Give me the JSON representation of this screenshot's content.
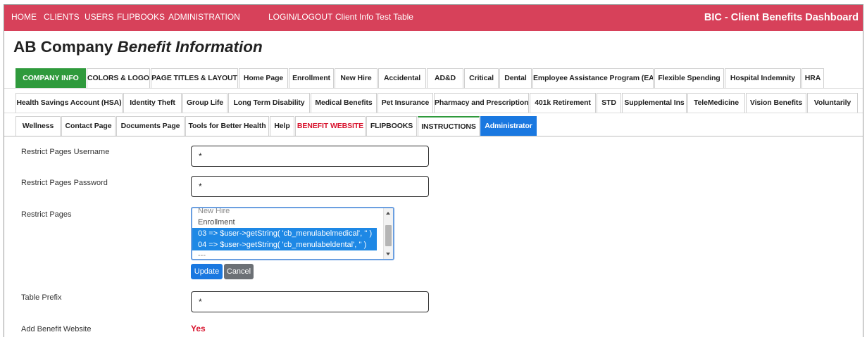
{
  "topnav": {
    "items": [
      "HOME",
      "CLIENTS",
      "USERS",
      "FLIPBOOKS",
      "ADMINISTRATION",
      "LOGIN/LOGOUT",
      "Client Info Test Table"
    ],
    "brand": "BIC - Client Benefits Dashboard",
    "background_color": "#d7415a"
  },
  "page": {
    "title_plain": "AB Company ",
    "title_italic": "Benefit Information"
  },
  "tabs": {
    "row0": [
      "COMPANY INFO",
      "COLORS & LOGO",
      "PAGE TITLES & LAYOUT",
      "Home Page",
      "Enrollment",
      "New Hire",
      "Accidental",
      "AD&D",
      "Critical",
      "Dental",
      "Employee Assistance Program (EAP)",
      "Flexible Spending",
      "Hospital Indemnity",
      "HRA"
    ],
    "row1": [
      "Health Savings Account (HSA)",
      "Identity Theft",
      "Group Life",
      "Long Term Disability",
      "Medical Benefits",
      "Pet Insurance",
      "Pharmacy and Prescriptions",
      "401k Retirement",
      "STD",
      "Supplemental Ins",
      "TeleMedicine",
      "Vision Benefits",
      "Voluntarily"
    ],
    "row2": [
      "Wellness",
      "Contact Page",
      "Documents Page",
      "Tools for Better Health",
      "Help",
      "BENEFIT WEBSITE",
      "FLIPBOOKS",
      "INSTRUCTIONS",
      "Administrator"
    ],
    "active_color": "#2f9a3c",
    "highlight_color": "#1a78e0",
    "alert_text_color": "#d8142e"
  },
  "form": {
    "username": {
      "label": "Restrict Pages Username",
      "value": "*"
    },
    "password": {
      "label": "Restrict Pages Password",
      "value": "*"
    },
    "restrict_pages": {
      "label": "Restrict Pages",
      "options": [
        {
          "text": "New Hire",
          "selected": false
        },
        {
          "text": "Enrollment",
          "selected": false
        },
        {
          "text": "03 => $user->getString( 'cb_menulabelmedical', '' )",
          "selected": true
        },
        {
          "text": "04 => $user->getString( 'cb_menulabeldental', '' )",
          "selected": true
        },
        {
          "text": "---",
          "selected": false
        }
      ]
    },
    "update_label": "Update",
    "cancel_label": "Cancel",
    "table_prefix": {
      "label": "Table Prefix",
      "value": "*"
    },
    "add_benefit_website": {
      "label": "Add Benefit Website",
      "value": "Yes"
    }
  }
}
